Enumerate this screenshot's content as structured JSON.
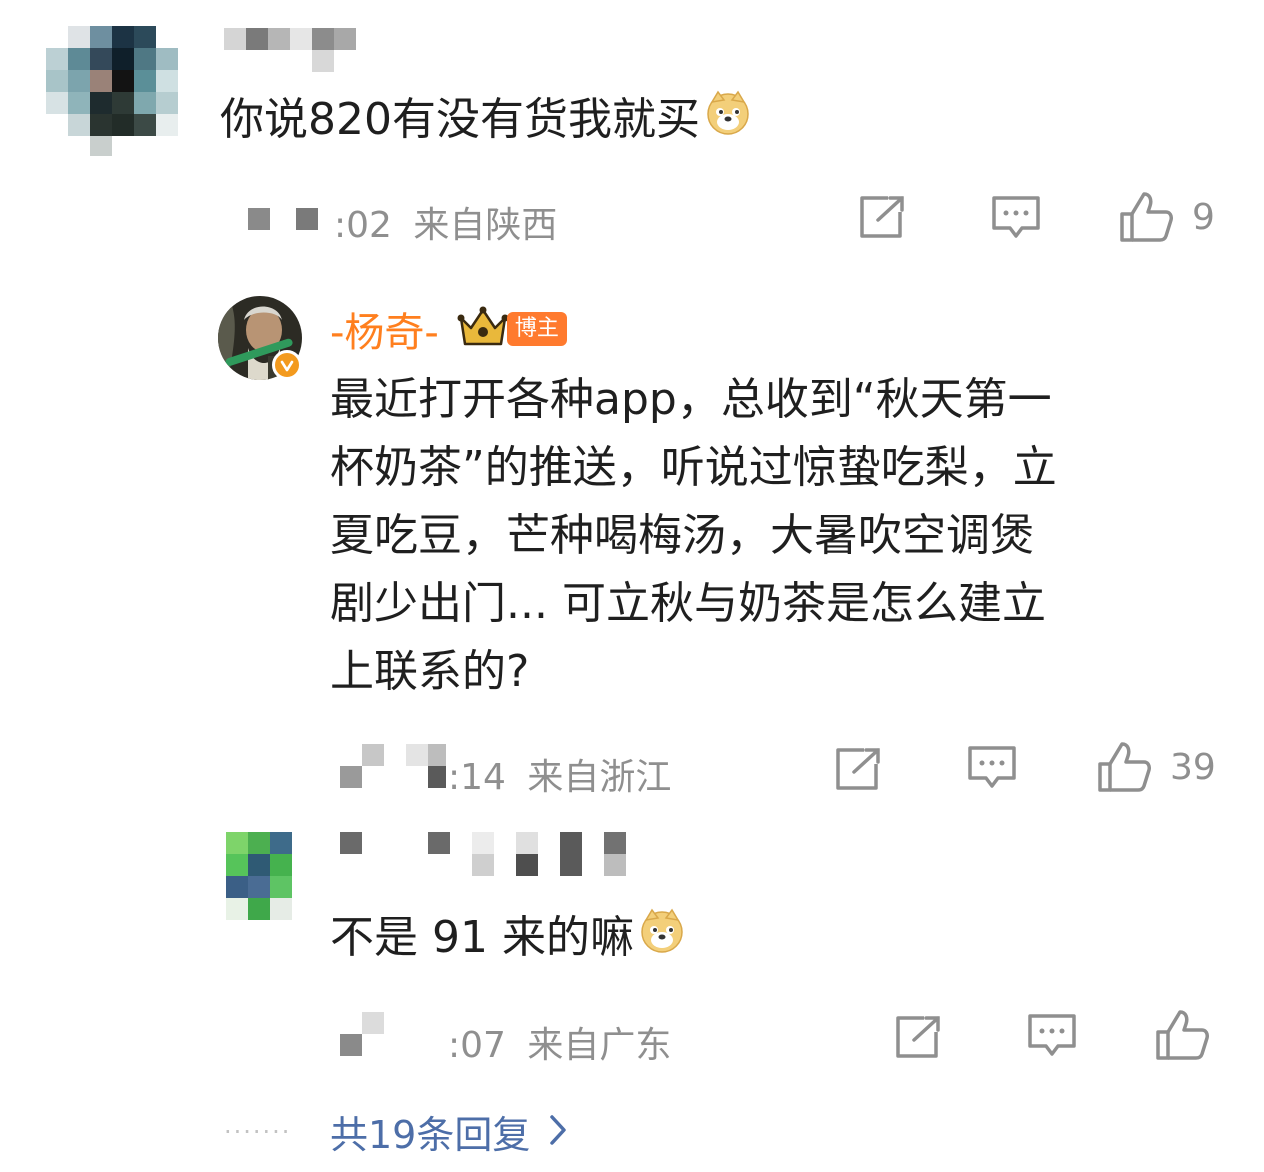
{
  "comments": [
    {
      "text": "你说820有没有货我就买",
      "time": ":02",
      "location": "来自陕西",
      "likes": "9",
      "emoji": "doge-emoji"
    },
    {
      "author": "-杨奇-",
      "badge": "博主",
      "text_lines": [
        "最近打开各种app，总收到“秋天第一",
        "杯奶茶”的推送，听说过惊蛰吃梨，立",
        "夏吃豆，芒种喝梅汤，大暑吹空调煲",
        "剧少出门... 可立秋与奶茶是怎么建立",
        "上联系的?"
      ],
      "time": ":14",
      "location": "来自浙江",
      "likes": "39"
    },
    {
      "text": "不是 91 来的嘛",
      "time": ":07",
      "location": "来自广东",
      "emoji": "doge-emoji"
    }
  ],
  "more_replies": "共19条回复",
  "more_dots": "·······",
  "colors": {
    "orange": "#ff7f1e",
    "link": "#4d6ea8",
    "meta": "#8f8f8f"
  }
}
